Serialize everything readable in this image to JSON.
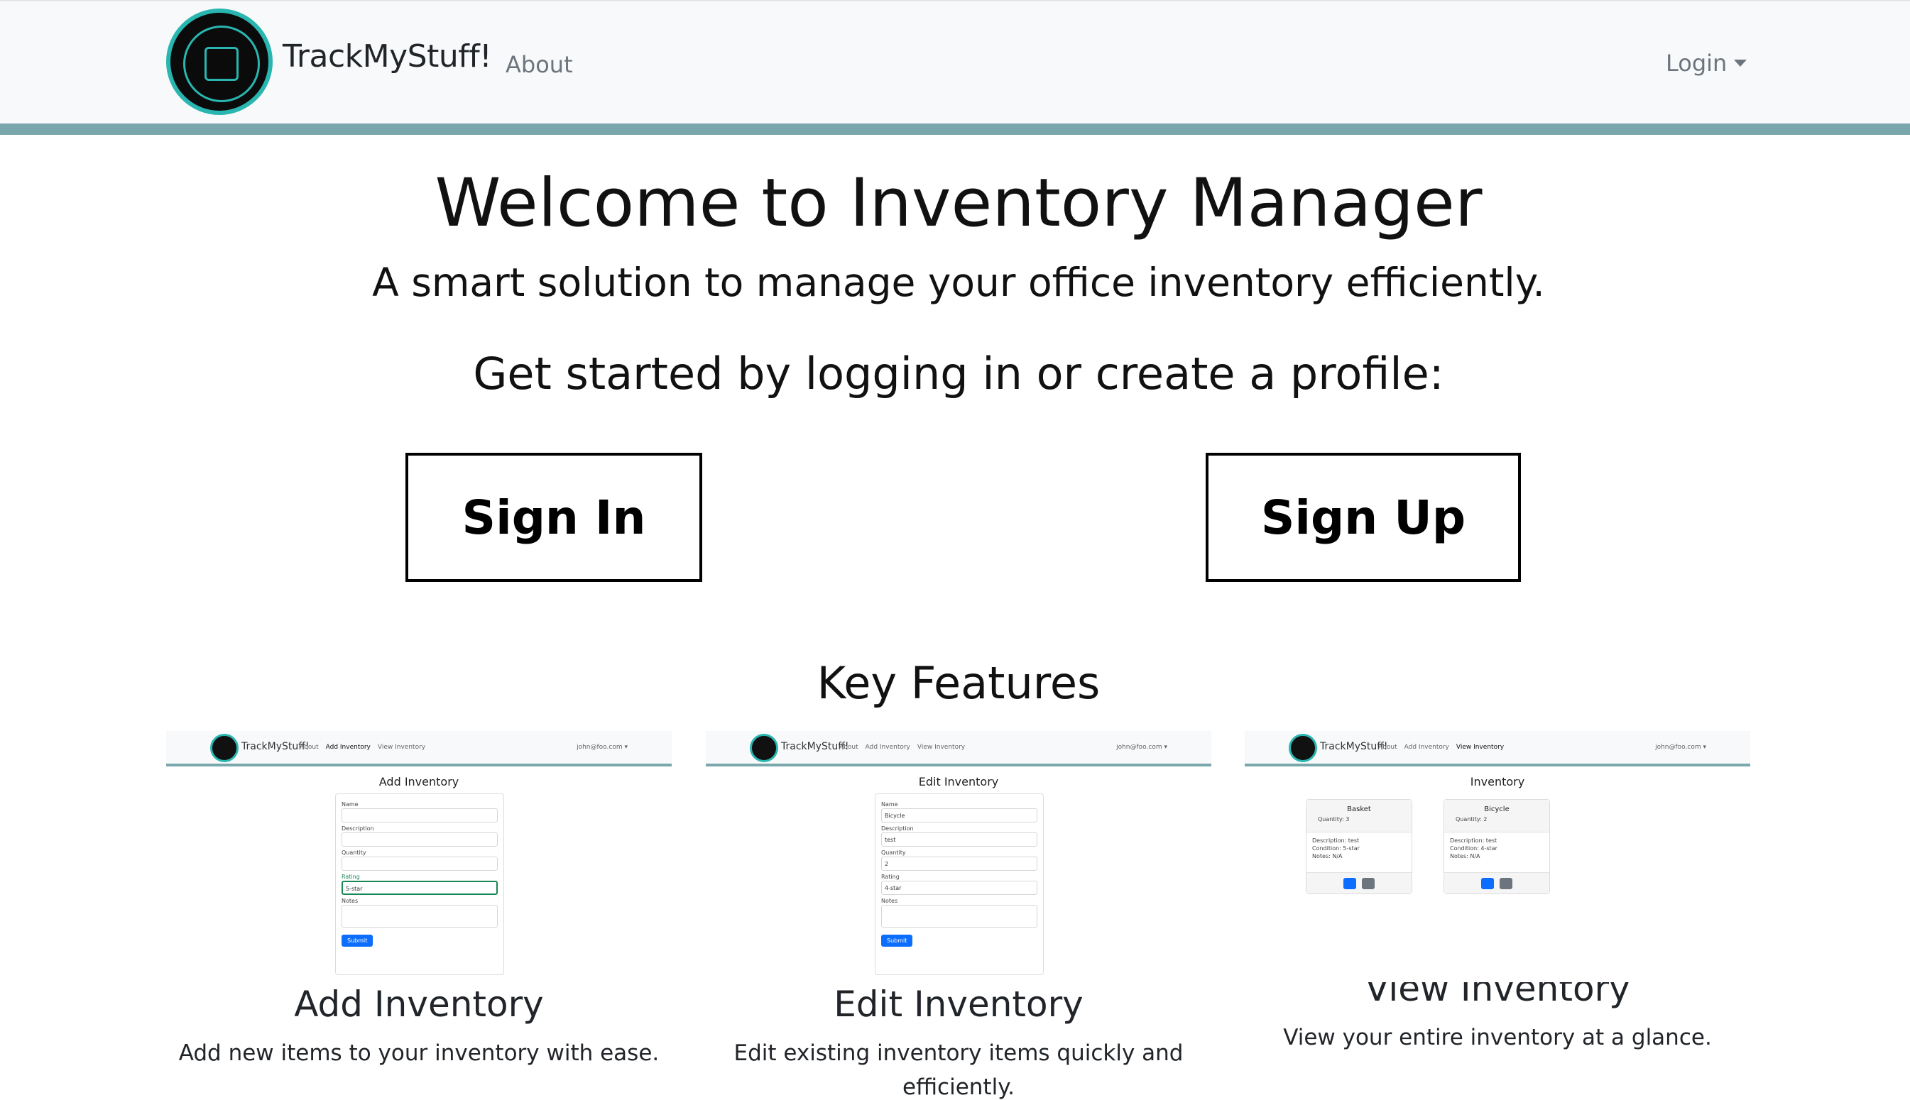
{
  "navbar": {
    "brand": "TrackMyStuff!",
    "about": "About",
    "login": "Login"
  },
  "hero": {
    "title": "Welcome to Inventory Manager",
    "subtitle": "A smart solution to manage your office inventory efficiently.",
    "cta": "Get started by logging in or create a profile:",
    "sign_in": "Sign In",
    "sign_up": "Sign Up"
  },
  "features": {
    "title": "Key Features",
    "items": [
      {
        "name": "Add Inventory",
        "desc": "Add new items to your inventory with ease.",
        "shot": {
          "brand": "TrackMyStuff!",
          "links": [
            "About",
            "Add Inventory",
            "View Inventory"
          ],
          "user": "john@foo.com ▾",
          "page_title": "Add Inventory",
          "fields": [
            {
              "label": "Name",
              "value": ""
            },
            {
              "label": "Description",
              "value": ""
            },
            {
              "label": "Quantity",
              "value": ""
            },
            {
              "label": "Rating",
              "value": "5-star"
            }
          ],
          "notes_label": "Notes",
          "submit": "Submit"
        }
      },
      {
        "name": "Edit Inventory",
        "desc": "Edit existing inventory items quickly and efficiently.",
        "shot": {
          "brand": "TrackMyStuff!",
          "links": [
            "About",
            "Add Inventory",
            "View Inventory"
          ],
          "user": "john@foo.com ▾",
          "page_title": "Edit Inventory",
          "fields": [
            {
              "label": "Name",
              "value": "Bicycle"
            },
            {
              "label": "Description",
              "value": "test"
            },
            {
              "label": "Quantity",
              "value": "2"
            },
            {
              "label": "Rating",
              "value": "4-star"
            }
          ],
          "notes_label": "Notes",
          "submit": "Submit"
        }
      },
      {
        "name": "View Inventory",
        "desc": "View your entire inventory at a glance.",
        "shot": {
          "brand": "TrackMyStuff!",
          "links": [
            "About",
            "Add Inventory",
            "View Inventory"
          ],
          "user": "john@foo.com ▾",
          "page_title": "Inventory",
          "cards": [
            {
              "name": "Basket",
              "qty": "Quantity: 3",
              "desc": "Description: test",
              "cond": "Condition: 5-star",
              "notes": "Notes: N/A"
            },
            {
              "name": "Bicycle",
              "qty": "Quantity: 2",
              "desc": "Description: test",
              "cond": "Condition: 4-star",
              "notes": "Notes: N/A"
            }
          ]
        }
      }
    ]
  }
}
